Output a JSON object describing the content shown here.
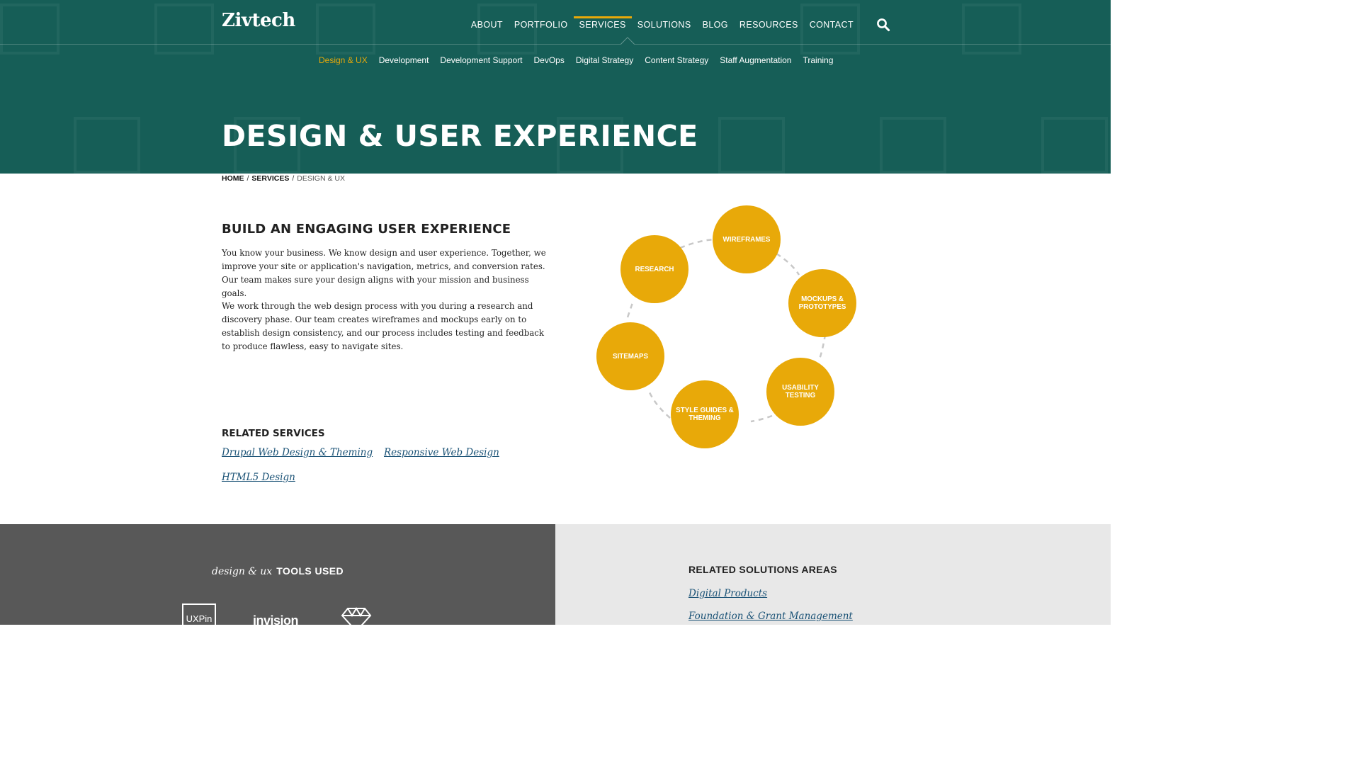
{
  "header": {
    "logo_text": "Zivtech",
    "nav": [
      {
        "label": "ABOUT"
      },
      {
        "label": "PORTFOLIO"
      },
      {
        "label": "SERVICES",
        "active": true
      },
      {
        "label": "SOLUTIONS"
      },
      {
        "label": "BLOG"
      },
      {
        "label": "RESOURCES"
      },
      {
        "label": "CONTACT"
      }
    ],
    "search_icon": "search-icon",
    "subnav": [
      {
        "label": "Design & UX",
        "active": true
      },
      {
        "label": "Development"
      },
      {
        "label": "Development Support"
      },
      {
        "label": "DevOps"
      },
      {
        "label": "Digital Strategy"
      },
      {
        "label": "Content Strategy"
      },
      {
        "label": "Staff Augmentation"
      },
      {
        "label": "Training"
      }
    ],
    "page_title": "DESIGN & USER EXPERIENCE"
  },
  "breadcrumb": {
    "home": "HOME",
    "services": "SERVICES",
    "current": "DESIGN & UX",
    "sep": "/"
  },
  "intro": {
    "heading": "BUILD AN ENGAGING USER EXPERIENCE",
    "paragraph1": "You know your business. We know design and user experience. Together, we improve your site or application's navigation, metrics, and conversion rates. Our team makes sure your design aligns with your mission and business goals.",
    "paragraph2": "We work through the web design process with you during a research and discovery phase. Our team creates wireframes and mockups early on to establish design consistency, and our process includes testing and feedback to produce flawless, easy to navigate sites."
  },
  "related_services": {
    "heading": "RELATED SERVICES",
    "links": [
      "Drupal Web Design & Theming",
      "Responsive Web Design",
      "HTML5 Design"
    ]
  },
  "process_diagram": {
    "steps": [
      "RESEARCH",
      "WIREFRAMES",
      "MOCKUPS & PROTOTYPES",
      "USABILITY TESTING",
      "STYLE GUIDES & THEMING",
      "SITEMAPS"
    ]
  },
  "tools": {
    "title_italic": "design & ux",
    "title": "TOOLS USED",
    "logos": [
      "UXPin",
      "invision",
      "sketch-diamond-icon"
    ]
  },
  "solutions": {
    "heading": "RELATED SOLUTIONS AREAS",
    "links": [
      "Digital Products",
      "Foundation & Grant Management"
    ]
  },
  "colors": {
    "hero_bg": "#165e57",
    "accent": "#e8a909",
    "tools_bg": "#585858",
    "solutions_bg": "#e8e8e8",
    "link": "#1a5276"
  }
}
